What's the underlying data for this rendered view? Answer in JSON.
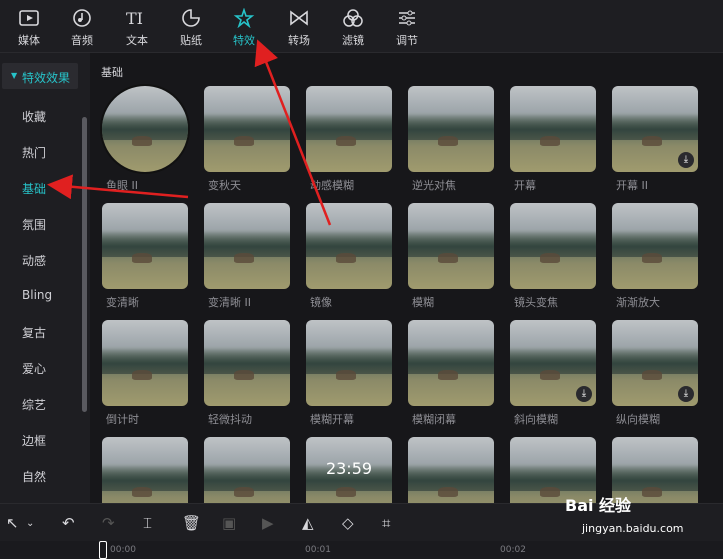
{
  "top_tabs": [
    {
      "label": "媒体",
      "icon": "media-icon"
    },
    {
      "label": "音频",
      "icon": "audio-icon"
    },
    {
      "label": "文本",
      "icon": "text-icon"
    },
    {
      "label": "贴纸",
      "icon": "sticker-icon"
    },
    {
      "label": "特效",
      "icon": "effects-icon",
      "active": true
    },
    {
      "label": "转场",
      "icon": "transition-icon"
    },
    {
      "label": "滤镜",
      "icon": "filter-icon"
    },
    {
      "label": "调节",
      "icon": "adjust-icon"
    }
  ],
  "sidebar": {
    "header": "特效效果",
    "items": [
      "收藏",
      "热门",
      "基础",
      "氛围",
      "动感",
      "Bling",
      "复古",
      "爱心",
      "综艺",
      "边框",
      "自然"
    ],
    "active": "基础"
  },
  "content": {
    "section_title": "基础",
    "effects": [
      {
        "label": "鱼眼 II"
      },
      {
        "label": "变秋天"
      },
      {
        "label": "动感模糊"
      },
      {
        "label": "逆光对焦"
      },
      {
        "label": "开幕"
      },
      {
        "label": "开幕 II",
        "download": true
      },
      {
        "label": "变清晰"
      },
      {
        "label": "变清晰 II"
      },
      {
        "label": "镜像"
      },
      {
        "label": "模糊"
      },
      {
        "label": "镜头变焦"
      },
      {
        "label": "渐渐放大"
      },
      {
        "label": "倒计时"
      },
      {
        "label": "轻微抖动"
      },
      {
        "label": "模糊开幕"
      },
      {
        "label": "模糊闭幕"
      },
      {
        "label": "斜向模糊",
        "download": true
      },
      {
        "label": "纵向模糊",
        "download": true
      },
      {
        "label": ""
      },
      {
        "label": ""
      },
      {
        "label": "",
        "overlay": "23:59"
      },
      {
        "label": ""
      },
      {
        "label": ""
      },
      {
        "label": ""
      }
    ]
  },
  "bottom_toolbar": {
    "ticks": [
      "00:00",
      "00:01",
      "00:02"
    ]
  },
  "watermark": {
    "brand": "Bai 经验",
    "url": "jingyan.baidu.com"
  },
  "colors": {
    "accent": "#27c3c9",
    "arrow": "#e02020"
  }
}
